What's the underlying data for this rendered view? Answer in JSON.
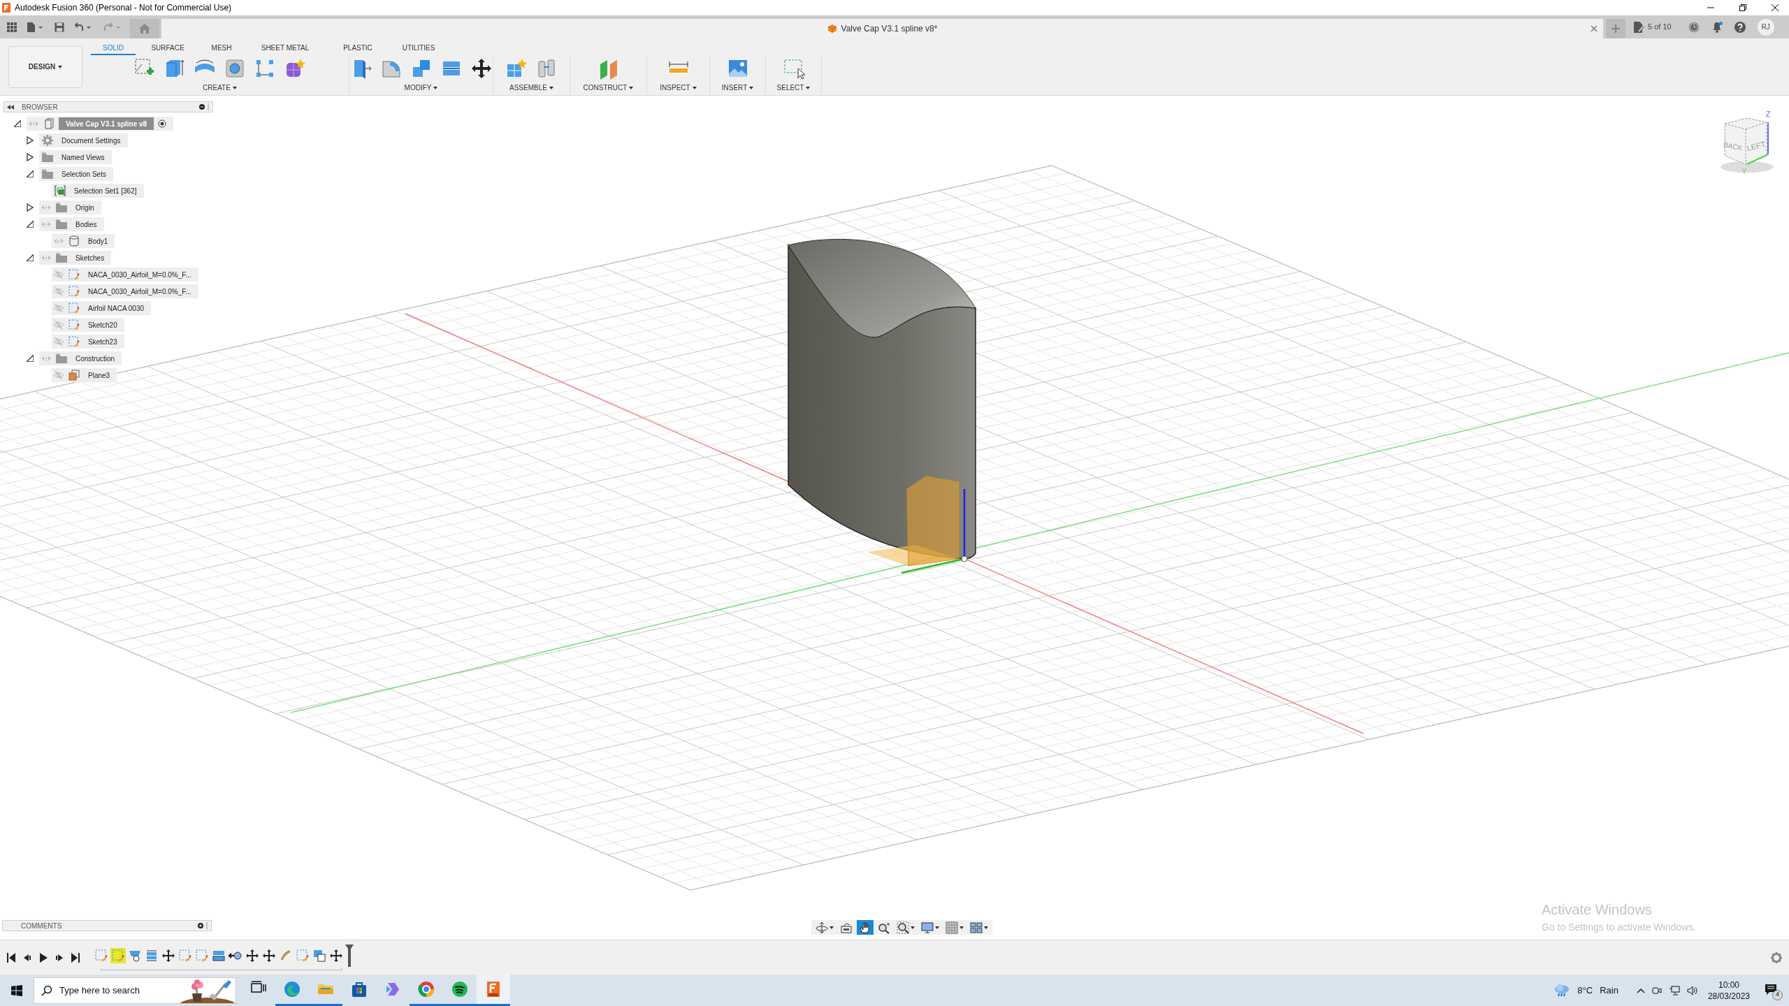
{
  "title_bar": {
    "title": "Autodesk Fusion 360 (Personal - Not for Commercial Use)"
  },
  "document_tab": {
    "title": "Valve Cap V3.1 spline v8*"
  },
  "job_status": "5 of 10",
  "notifications": {
    "unread": true
  },
  "user_initials": "RJ",
  "workspace": "DESIGN",
  "toolbar_tabs": [
    {
      "label": "SOLID",
      "selected": true
    },
    {
      "label": "SURFACE",
      "selected": false
    },
    {
      "label": "MESH",
      "selected": false
    },
    {
      "label": "SHEET METAL",
      "selected": false
    },
    {
      "label": "PLASTIC",
      "selected": false
    },
    {
      "label": "UTILITIES",
      "selected": false
    }
  ],
  "toolbar_groups": [
    "CREATE",
    "MODIFY",
    "ASSEMBLE",
    "CONSTRUCT",
    "INSPECT",
    "INSERT",
    "SELECT"
  ],
  "browser": {
    "title": "BROWSER",
    "root": {
      "label": "Valve Cap V3.1 spline v8",
      "kind": "component",
      "visible": true,
      "active": true,
      "expanded": true,
      "children": [
        {
          "label": "Document Settings",
          "kind": "settings",
          "expanded": false
        },
        {
          "label": "Named Views",
          "kind": "folder",
          "expanded": false
        },
        {
          "label": "Selection Sets",
          "kind": "folder",
          "expanded": true,
          "children": [
            {
              "label": "Selection Set1 [362]",
              "kind": "selection_set"
            }
          ]
        },
        {
          "label": "Origin",
          "kind": "folder",
          "visible": true,
          "expanded": false
        },
        {
          "label": "Bodies",
          "kind": "folder",
          "visible": true,
          "expanded": true,
          "children": [
            {
              "label": "Body1",
              "kind": "body",
              "visible": true
            }
          ]
        },
        {
          "label": "Sketches",
          "kind": "folder",
          "visible": true,
          "expanded": true,
          "children": [
            {
              "label": "NACA_0030_Airfoil_M=0.0%_F...",
              "kind": "sketch",
              "visible": false
            },
            {
              "label": "NACA_0030_Airfoil_M=0.0%_F...",
              "kind": "sketch",
              "visible": false
            },
            {
              "label": "Airfoil NACA 0030",
              "kind": "sketch",
              "visible": false
            },
            {
              "label": "Sketch20",
              "kind": "sketch",
              "visible": false
            },
            {
              "label": "Sketch23",
              "kind": "sketch",
              "visible": false
            }
          ]
        },
        {
          "label": "Construction",
          "kind": "folder",
          "visible": true,
          "expanded": true,
          "children": [
            {
              "label": "Plane3",
              "kind": "plane",
              "visible": false
            }
          ]
        }
      ]
    }
  },
  "view_cube": {
    "faces": [
      "BACK",
      "LEFT"
    ],
    "axes": [
      "Z",
      "Y"
    ]
  },
  "comments": {
    "title": "COMMENTS"
  },
  "nav_tools": [
    {
      "kind": "orbit",
      "selected": false,
      "menu": true
    },
    {
      "kind": "look_at",
      "selected": false,
      "menu": false
    },
    {
      "kind": "pan",
      "selected": true,
      "menu": false
    },
    {
      "kind": "zoom",
      "selected": false,
      "menu": false
    },
    {
      "kind": "fit",
      "selected": false,
      "menu": true
    },
    {
      "kind": "display",
      "selected": false,
      "menu": true
    },
    {
      "kind": "grid",
      "selected": false,
      "menu": true
    },
    {
      "kind": "viewports",
      "selected": false,
      "menu": true
    }
  ],
  "timeline": {
    "features": [
      {
        "kind": "sketch",
        "selected": false
      },
      {
        "kind": "sketch",
        "selected": true
      },
      {
        "kind": "revolve",
        "selected": false
      },
      {
        "kind": "plane",
        "selected": false
      },
      {
        "kind": "move",
        "selected": false
      },
      {
        "kind": "sketch",
        "selected": false
      },
      {
        "kind": "sketch",
        "selected": false
      },
      {
        "kind": "extrude",
        "selected": false
      },
      {
        "kind": "point",
        "selected": false
      },
      {
        "kind": "move",
        "selected": false
      },
      {
        "kind": "move",
        "selected": false
      },
      {
        "kind": "loft",
        "selected": false
      },
      {
        "kind": "sketch",
        "selected": false
      },
      {
        "kind": "combine",
        "selected": false
      },
      {
        "kind": "move",
        "selected": false
      }
    ]
  },
  "activation_notice": {
    "title": "Activate Windows",
    "message": "Go to Settings to activate Windows."
  },
  "taskbar": {
    "search_placeholder": "Type here to search",
    "apps": [
      {
        "kind": "task_view",
        "running": false,
        "active": false
      },
      {
        "kind": "edge",
        "running": true,
        "active": false
      },
      {
        "kind": "explorer",
        "running": true,
        "active": false
      },
      {
        "kind": "store",
        "running": false,
        "active": false
      },
      {
        "kind": "copilot",
        "running": false,
        "active": false
      },
      {
        "kind": "chrome",
        "running": true,
        "active": false
      },
      {
        "kind": "spotify",
        "running": true,
        "active": false
      },
      {
        "kind": "fusion",
        "running": true,
        "active": true
      }
    ],
    "weather": "8°C",
    "weather_condition": "Rain",
    "time": "10:00",
    "date": "28/03/2023",
    "notification_count": "4"
  }
}
